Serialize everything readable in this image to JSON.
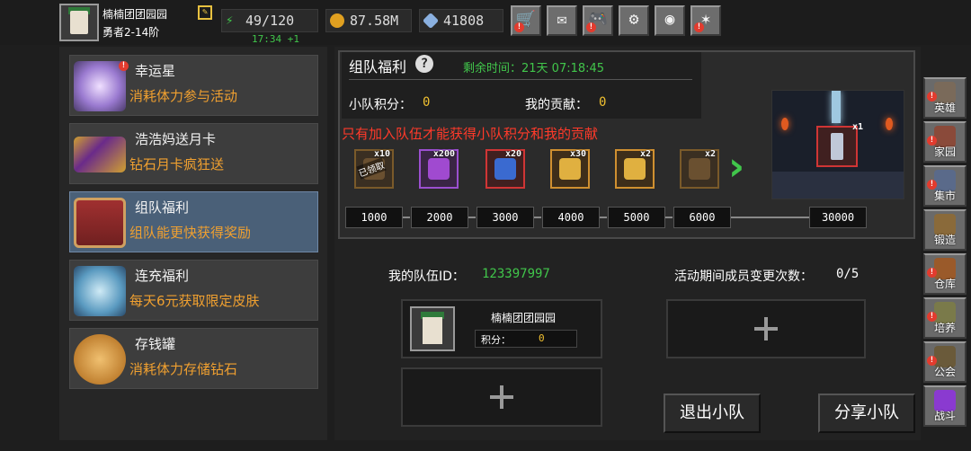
{
  "player": {
    "name": "楠楠团团园园",
    "rank": "勇者2-14阶"
  },
  "resources": {
    "energy": "49/120",
    "energy_regen": "17:34 +1",
    "gold": "87.58M",
    "gems": "41808"
  },
  "top_buttons": [
    {
      "icon": "shop-cart-icon",
      "glyph": "🛒"
    },
    {
      "icon": "mail-icon",
      "glyph": "✉"
    },
    {
      "icon": "gamepad-icon",
      "glyph": "🎮"
    },
    {
      "icon": "gear-icon",
      "glyph": "⚙"
    },
    {
      "icon": "color-wheel-icon",
      "glyph": "◉"
    },
    {
      "icon": "fireworks-icon",
      "glyph": "✶"
    }
  ],
  "events": [
    {
      "title": "幸运星",
      "subtitle": "消耗体力参与活动"
    },
    {
      "title": "浩浩妈送月卡",
      "subtitle": "钻石月卡疯狂送"
    },
    {
      "title": "组队福利",
      "subtitle": "组队能更快获得奖励"
    },
    {
      "title": "连充福利",
      "subtitle": "每天6元获取限定皮肤"
    },
    {
      "title": "存钱罐",
      "subtitle": "消耗体力存储钻石"
    }
  ],
  "team_benefit": {
    "title": "组队福利",
    "help": "?",
    "time_label": "剩余时间：21天 07:18:45",
    "team_points_label": "小队积分：",
    "team_points": "0",
    "contribution_label": "我的贡献：",
    "contribution": "0",
    "warning": "只有加入队伍才能获得小队积分和我的贡献",
    "rewards": [
      {
        "qty": "x10",
        "tier": "brown",
        "claimed": "已领取"
      },
      {
        "qty": "x200",
        "tier": "purple"
      },
      {
        "qty": "x20",
        "tier": "red"
      },
      {
        "qty": "x30",
        "tier": "orange"
      },
      {
        "qty": "x2",
        "tier": "orange"
      },
      {
        "qty": "x2",
        "tier": "brown"
      }
    ],
    "next_arrow": "›",
    "milestones": [
      "1000",
      "2000",
      "3000",
      "4000",
      "5000",
      "6000"
    ],
    "final_milestone": "30000",
    "final_reward_qty": "x1"
  },
  "team": {
    "id_label": "我的队伍ID：",
    "id": "123397997",
    "member_changes_label": "活动期间成员变更次数：",
    "member_changes": "0/5",
    "member": {
      "name": "楠楠团团园园",
      "points_label": "积分：",
      "points": "0"
    },
    "leave_label": "退出小队",
    "share_label": "分享小队"
  },
  "sidebar": [
    {
      "label": "英雄",
      "icon": "helmet-icon",
      "color": "#7a6a5a"
    },
    {
      "label": "家园",
      "icon": "castle-icon",
      "color": "#8a4a3a"
    },
    {
      "label": "集市",
      "icon": "market-icon",
      "color": "#5a6a8a"
    },
    {
      "label": "锻造",
      "icon": "anvil-icon",
      "color": "#8a6a3a"
    },
    {
      "label": "仓库",
      "icon": "treasure-icon",
      "color": "#9a5a2a"
    },
    {
      "label": "培养",
      "icon": "chalice-icon",
      "color": "#7a7a4a"
    },
    {
      "label": "公会",
      "icon": "guild-icon",
      "color": "#6a5a3a"
    },
    {
      "label": "战斗",
      "icon": "portal-icon",
      "color": "#8a3ad0"
    }
  ],
  "colors": {
    "accent_green": "#41c64b",
    "warning_red": "#ff3a2a",
    "subtitle_orange": "#f0a030",
    "active_card": "#4a6078"
  }
}
